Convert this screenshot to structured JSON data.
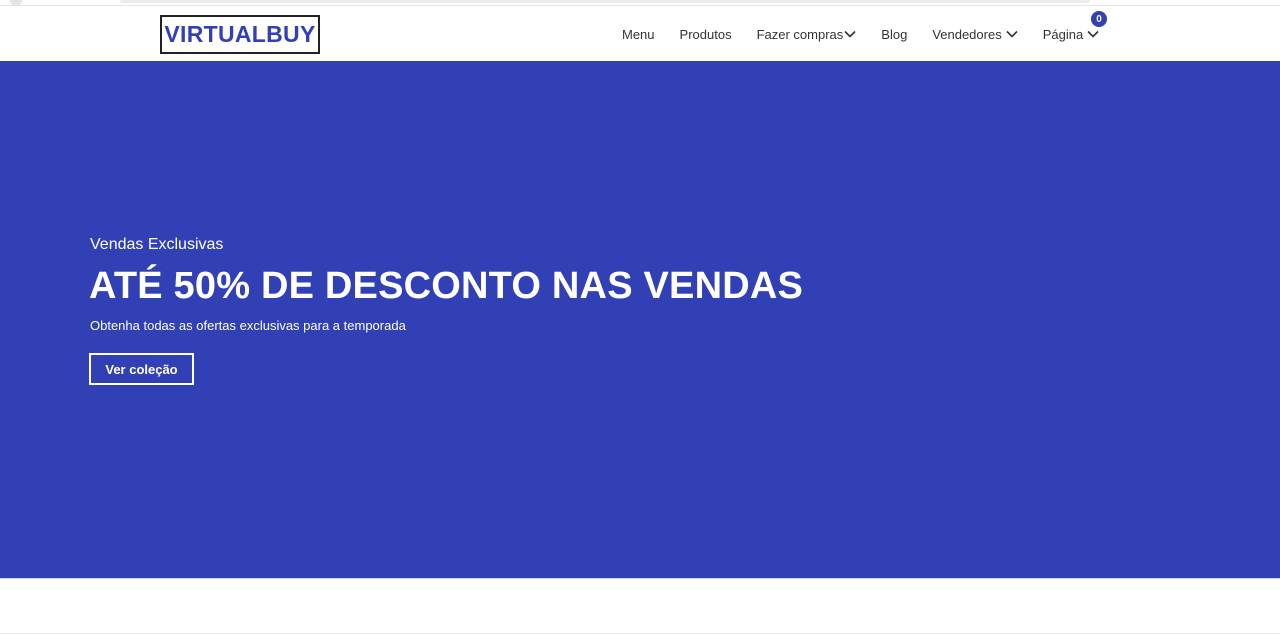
{
  "brand": {
    "logo_text": "VIRTUALBUY"
  },
  "nav": {
    "items": [
      {
        "label": "Menu",
        "has_dropdown": false
      },
      {
        "label": "Produtos",
        "has_dropdown": false
      },
      {
        "label": "Fazer compras",
        "has_dropdown": true
      },
      {
        "label": "Blog",
        "has_dropdown": false
      },
      {
        "label": "Vendedores",
        "has_dropdown": true
      },
      {
        "label": "Página",
        "has_dropdown": true
      }
    ],
    "cart_count": "0",
    "dropdown_icon": "chevron-down-icon"
  },
  "hero": {
    "subtitle": "Vendas Exclusivas",
    "title": "ATÉ 50% DE DESCONTO NAS VENDAS",
    "description": "Obtenha todas as ofertas exclusivas para a temporada",
    "cta_label": "Ver coleção"
  },
  "colors": {
    "brand_blue": "#3140b5",
    "text_dark": "#333333",
    "white": "#ffffff"
  }
}
